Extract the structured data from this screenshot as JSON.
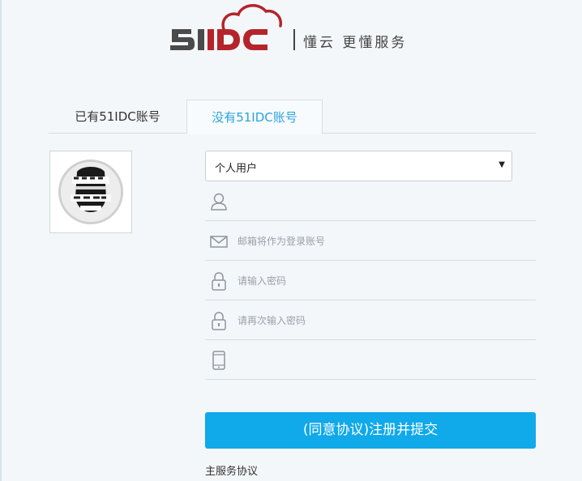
{
  "header": {
    "logo_text": "51IDC",
    "slogan": "懂云 更懂服务"
  },
  "tabs": [
    {
      "label": "已有51IDC账号",
      "active": false
    },
    {
      "label": "没有51IDC账号",
      "active": true
    }
  ],
  "avatar": {
    "icon": "avatar-image",
    "alt": "user avatar"
  },
  "form": {
    "user_type": {
      "value": "个人用户",
      "options": [
        "个人用户"
      ]
    },
    "username": {
      "placeholder": "",
      "icon": "user-icon"
    },
    "email": {
      "placeholder": "邮箱将作为登录账号",
      "icon": "mail-icon"
    },
    "password": {
      "placeholder": "请输入密码",
      "icon": "lock-icon"
    },
    "password_confirm": {
      "placeholder": "请再次输入密码",
      "icon": "lock-icon"
    },
    "phone": {
      "placeholder": "",
      "icon": "phone-icon"
    },
    "submit_label": "(同意协议)注册并提交",
    "agreement_link": "主服务协议"
  },
  "colors": {
    "accent": "#10a9ea",
    "tab_active_text": "#2aa3de",
    "logo_dark": "#4a4a4a",
    "logo_red": "#b5242a"
  }
}
